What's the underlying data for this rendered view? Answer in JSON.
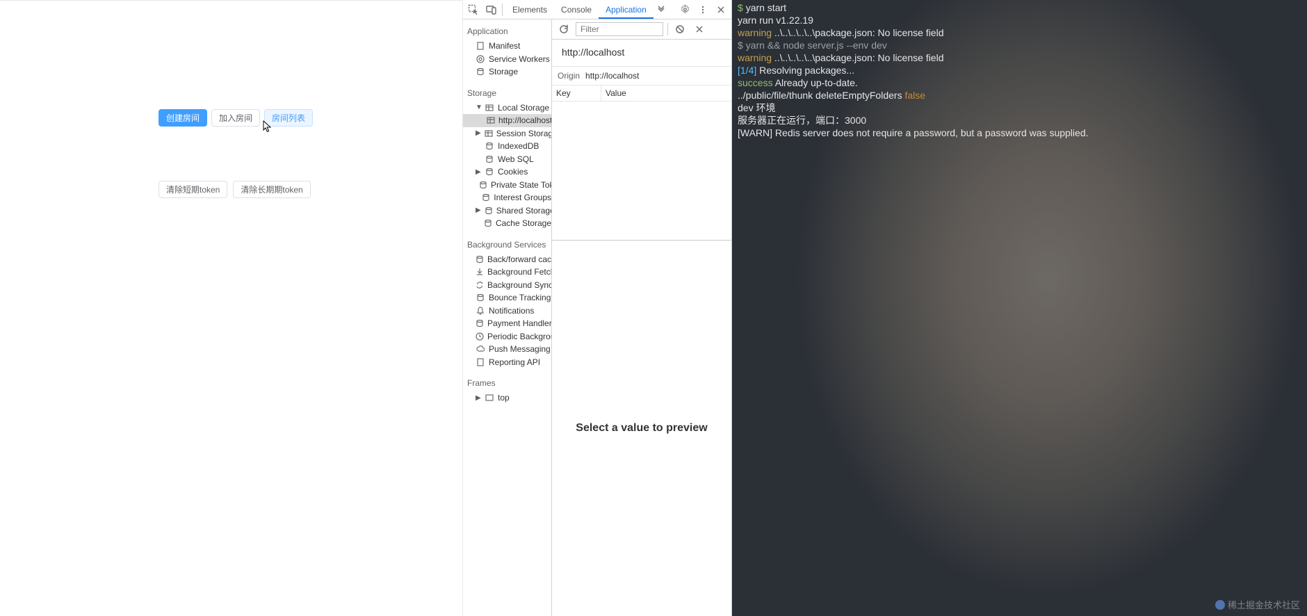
{
  "app": {
    "buttons": {
      "create_room": "创建房间",
      "join_room": "加入房间",
      "room_list": "房间列表",
      "clear_short_token": "清除短期token",
      "clear_long_token": "清除长期期token"
    }
  },
  "devtools": {
    "tabs": {
      "elements": "Elements",
      "console": "Console",
      "application": "Application"
    },
    "filter_placeholder": "Filter",
    "origin_title": "http://localhost",
    "origin_label": "Origin",
    "origin_value": "http://localhost",
    "table": {
      "key": "Key",
      "value": "Value"
    },
    "preview_text": "Select a value to preview",
    "sections": {
      "application": "Application",
      "storage": "Storage",
      "background_services": "Background Services",
      "frames": "Frames"
    },
    "items": {
      "manifest": "Manifest",
      "service_workers": "Service Workers",
      "storage": "Storage",
      "local_storage": "Local Storage",
      "local_storage_origin": "http://localhost",
      "session_storage": "Session Storage",
      "indexeddb": "IndexedDB",
      "web_sql": "Web SQL",
      "cookies": "Cookies",
      "private_state_tokens": "Private State Tokens",
      "interest_groups": "Interest Groups",
      "shared_storage": "Shared Storage",
      "cache_storage": "Cache Storage",
      "bf_cache": "Back/forward cache",
      "bg_fetch": "Background Fetch",
      "bg_sync": "Background Sync",
      "bounce_tracking": "Bounce Tracking",
      "notifications": "Notifications",
      "payment_handler": "Payment Handler",
      "periodic_bg": "Periodic Background Sync",
      "push_messaging": "Push Messaging",
      "reporting_api": "Reporting API",
      "top": "top"
    }
  },
  "terminal": {
    "lines": [
      {
        "segs": [
          {
            "c": "g",
            "t": "$ "
          },
          {
            "c": "",
            "t": "yarn start"
          }
        ]
      },
      {
        "segs": [
          {
            "c": "",
            "t": "yarn run v1.22.19"
          }
        ]
      },
      {
        "segs": [
          {
            "c": "y",
            "t": "warning"
          },
          {
            "c": "",
            "t": " ..\\..\\..\\..\\..\\package.json: No license field"
          }
        ]
      },
      {
        "segs": [
          {
            "c": "c",
            "t": "$ yarn && node server.js --env dev"
          }
        ]
      },
      {
        "segs": [
          {
            "c": "y",
            "t": "warning"
          },
          {
            "c": "",
            "t": " ..\\..\\..\\..\\..\\package.json: No license field"
          }
        ]
      },
      {
        "segs": [
          {
            "c": "b",
            "t": "[1/4]"
          },
          {
            "c": "",
            "t": " Resolving packages..."
          }
        ]
      },
      {
        "segs": [
          {
            "c": "g",
            "t": "success"
          },
          {
            "c": "",
            "t": " Already up-to-date."
          }
        ]
      },
      {
        "segs": [
          {
            "c": "",
            "t": "../public/file/thunk deleteEmptyFolders "
          },
          {
            "c": "o",
            "t": "false"
          }
        ]
      },
      {
        "segs": [
          {
            "c": "",
            "t": "dev 环境"
          }
        ]
      },
      {
        "segs": [
          {
            "c": "",
            "t": "服务器正在运行，端口：3000"
          }
        ]
      },
      {
        "segs": [
          {
            "c": "",
            "t": "[WARN] Redis server does not require a password, but a password was supplied."
          }
        ]
      }
    ],
    "watermark": "稀土掘金技术社区"
  }
}
